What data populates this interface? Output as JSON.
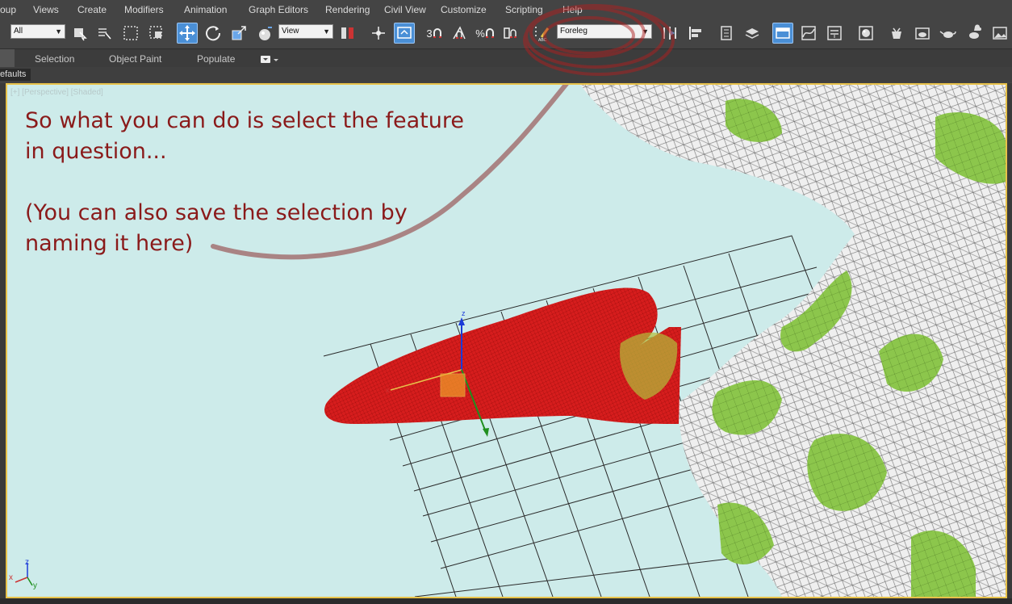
{
  "menu": [
    "oup",
    "Views",
    "Create",
    "Modifiers",
    "Animation",
    "Graph Editors",
    "Rendering",
    "Civil View",
    "Customize",
    "Scripting",
    "Help"
  ],
  "toolbar": {
    "selection_filter": "All",
    "reference_coord": "View",
    "named_selection_set": "Foreleg",
    "snap_label": "3",
    "percent_label": "%"
  },
  "ribbon": {
    "tabs": [
      "Selection",
      "Object Paint",
      "Populate"
    ]
  },
  "subbar": {
    "label": "efaults"
  },
  "viewport": {
    "label": "[+] [Perspective] [Shaded]",
    "axis_x": "x",
    "axis_y": "y",
    "axis_z": "z"
  },
  "annotation": {
    "line1": "So what you can do is select the feature\nin question...",
    "line2": "(You can also save the selection by\nnaming it here)"
  },
  "colors": {
    "annotation": "#8a1a1a",
    "selected_mesh": "#d61d1d",
    "viewport_bg": "#cdebea",
    "viewport_border": "#e8c24a"
  }
}
